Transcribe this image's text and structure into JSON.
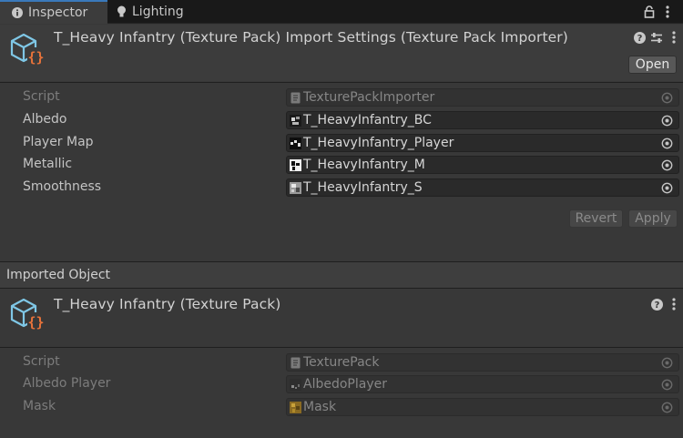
{
  "tabs": [
    {
      "label": "Inspector",
      "icon": "info-icon",
      "active": true
    },
    {
      "label": "Lighting",
      "icon": "lightbulb-icon",
      "active": false
    }
  ],
  "importer": {
    "title": "T_Heavy Infantry (Texture Pack) Import Settings (Texture Pack Importer)",
    "icon": "script-asset-icon",
    "open_label": "Open",
    "properties": [
      {
        "label": "Script",
        "value": "TexturePackImporter",
        "disabled": true,
        "thumb": "script-file-icon"
      },
      {
        "label": "Albedo",
        "value": "T_HeavyInfantry_BC",
        "disabled": false,
        "thumb": "texture-thumb-icon"
      },
      {
        "label": "Player Map",
        "value": "T_HeavyInfantry_Player",
        "disabled": false,
        "thumb": "texture-thumb-icon"
      },
      {
        "label": "Metallic",
        "value": "T_HeavyInfantry_M",
        "disabled": false,
        "thumb": "texture-thumb-icon"
      },
      {
        "label": "Smoothness",
        "value": "T_HeavyInfantry_S",
        "disabled": false,
        "thumb": "texture-thumb-icon"
      }
    ],
    "revert_label": "Revert",
    "apply_label": "Apply"
  },
  "imported": {
    "section_label": "Imported Object",
    "title": "T_Heavy Infantry (Texture Pack)",
    "properties": [
      {
        "label": "Script",
        "value": "TexturePack",
        "disabled": true,
        "thumb": "script-file-icon"
      },
      {
        "label": "Albedo Player",
        "value": "AlbedoPlayer",
        "disabled": true,
        "thumb": "texture-thumb-icon"
      },
      {
        "label": "Mask",
        "value": "Mask",
        "disabled": true,
        "thumb": "texture-thumb-icon"
      }
    ]
  },
  "colors": {
    "tab_accent": "#3a79bb",
    "icon_blue": "#7fc7e6",
    "icon_orange": "#e8733a"
  }
}
